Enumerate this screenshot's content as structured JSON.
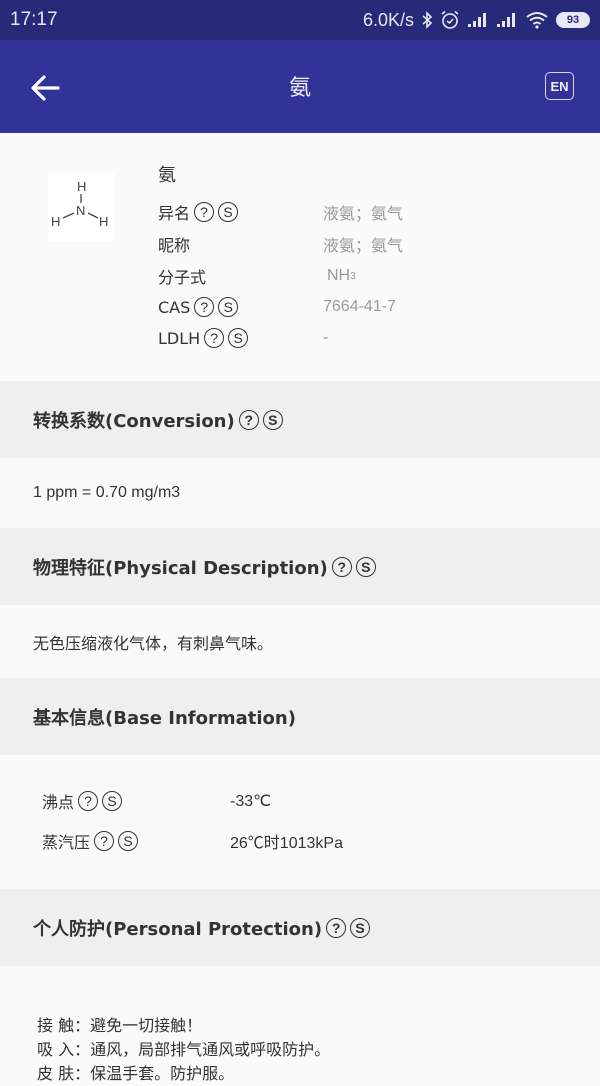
{
  "status_bar": {
    "time": "17:17",
    "net_speed": "6.0K/s",
    "icons": [
      "bluetooth-icon",
      "alarm-icon",
      "signal-icon",
      "signal-icon",
      "wifi-icon"
    ],
    "battery": "93"
  },
  "app_bar": {
    "title": "氨",
    "back_icon": "arrow-left-icon",
    "lang_button": "EN"
  },
  "compound": {
    "name": "氨",
    "structure": {
      "center": "N",
      "atoms": [
        "H",
        "H",
        "H"
      ]
    },
    "properties": [
      {
        "label": "异名",
        "help": true,
        "search": true,
        "value": "液氨；氨气"
      },
      {
        "label": "昵称",
        "help": false,
        "search": false,
        "value": "液氨；氨气"
      },
      {
        "label": "分子式",
        "help": false,
        "search": false,
        "value": "NH",
        "value_sub": "3"
      },
      {
        "label": "CAS",
        "help": true,
        "search": true,
        "value": "7664-41-7"
      },
      {
        "label": "LDLH",
        "help": true,
        "search": true,
        "value": "-"
      }
    ]
  },
  "icons": {
    "help": "?",
    "search": "S"
  },
  "sections": {
    "conversion": {
      "title": "转换系数(Conversion)",
      "body": "1 ppm = 0.70 mg/m3"
    },
    "physical": {
      "title": "物理特征(Physical Description)",
      "body": "无色压缩液化气体，有刺鼻气味。"
    },
    "base": {
      "title": "基本信息(Base Information)",
      "rows": [
        {
          "label": "沸点",
          "value": "-33℃"
        },
        {
          "label": "蒸汽压",
          "value": "26℃时1013kPa"
        }
      ]
    },
    "protection": {
      "title": "个人防护(Personal Protection)",
      "lines": [
        "接 触：避免一切接触！",
        "吸 入：通风，局部排气通风或呼吸防护。",
        "皮 肤：保温手套。防护服。"
      ]
    }
  }
}
